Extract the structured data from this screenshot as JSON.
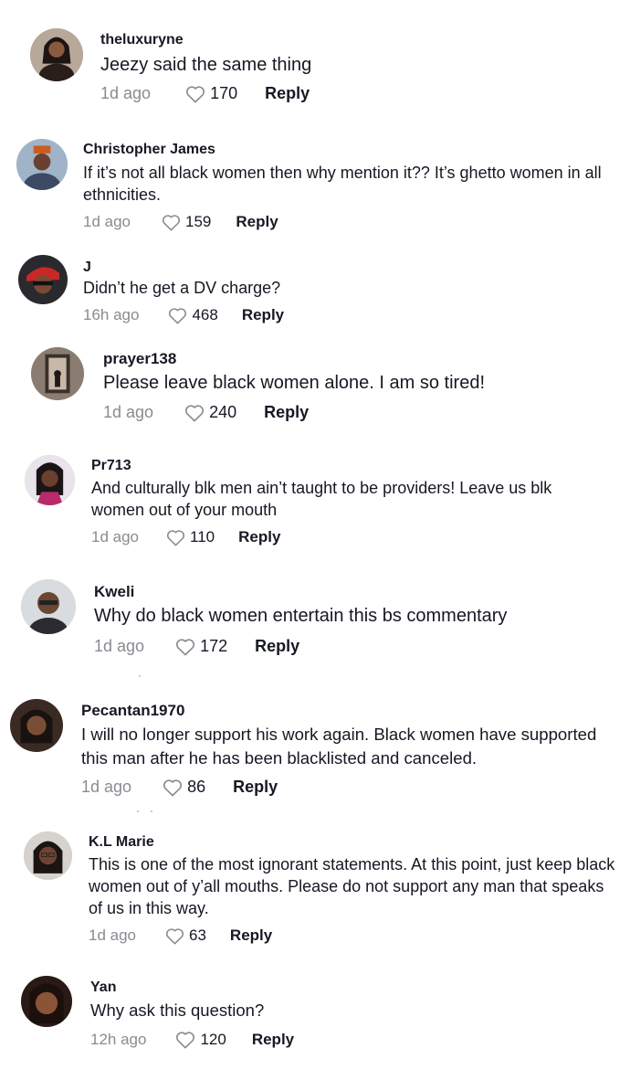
{
  "comments": [
    {
      "username": "theluxuryne",
      "text": "Jeezy said the same thing",
      "time": "1d ago",
      "likes": "170",
      "reply": "Reply",
      "avatar_icon": "user-avatar"
    },
    {
      "username": "Christopher James",
      "text": "If it’s not all black women then why mention it?? It’s ghetto women in all ethnicities.",
      "time": "1d ago",
      "likes": "159",
      "reply": "Reply",
      "avatar_icon": "user-avatar"
    },
    {
      "username": "J",
      "text": "Didn’t he get a DV charge?",
      "time": "16h ago",
      "likes": "468",
      "reply": "Reply",
      "avatar_icon": "user-avatar"
    },
    {
      "username": "prayer138",
      "text": "Please leave black women alone. I am so tired!",
      "time": "1d ago",
      "likes": "240",
      "reply": "Reply",
      "avatar_icon": "user-avatar"
    },
    {
      "username": "Pr713",
      "text": "And culturally blk men ain’t taught to be providers! Leave us blk women out of your mouth",
      "time": "1d ago",
      "likes": "110",
      "reply": "Reply",
      "avatar_icon": "user-avatar"
    },
    {
      "username": "Kweli",
      "text": "Why do black women entertain this bs commentary",
      "time": "1d ago",
      "likes": "172",
      "reply": "Reply",
      "avatar_icon": "user-avatar"
    },
    {
      "username": "Pecantan1970",
      "text": "I will no longer support his work again. Black women have supported this man after he has been blacklisted and canceled.",
      "time": "1d ago",
      "likes": "86",
      "reply": "Reply",
      "avatar_icon": "user-avatar"
    },
    {
      "username": "K.L Marie",
      "text": "This is one of the most ignorant statements. At this point, just keep black women out of y’all mouths. Please do not support any man that speaks of us in this way.",
      "time": "1d ago",
      "likes": "63",
      "reply": "Reply",
      "avatar_icon": "user-avatar"
    },
    {
      "username": "Yan",
      "text": "Why ask this question?",
      "time": "12h ago",
      "likes": "120",
      "reply": "Reply",
      "avatar_icon": "user-avatar"
    }
  ],
  "colors": {
    "text": "#161823",
    "muted": "#8a8b91",
    "background": "#ffffff"
  },
  "icons": {
    "like": "heart-outline-icon"
  }
}
